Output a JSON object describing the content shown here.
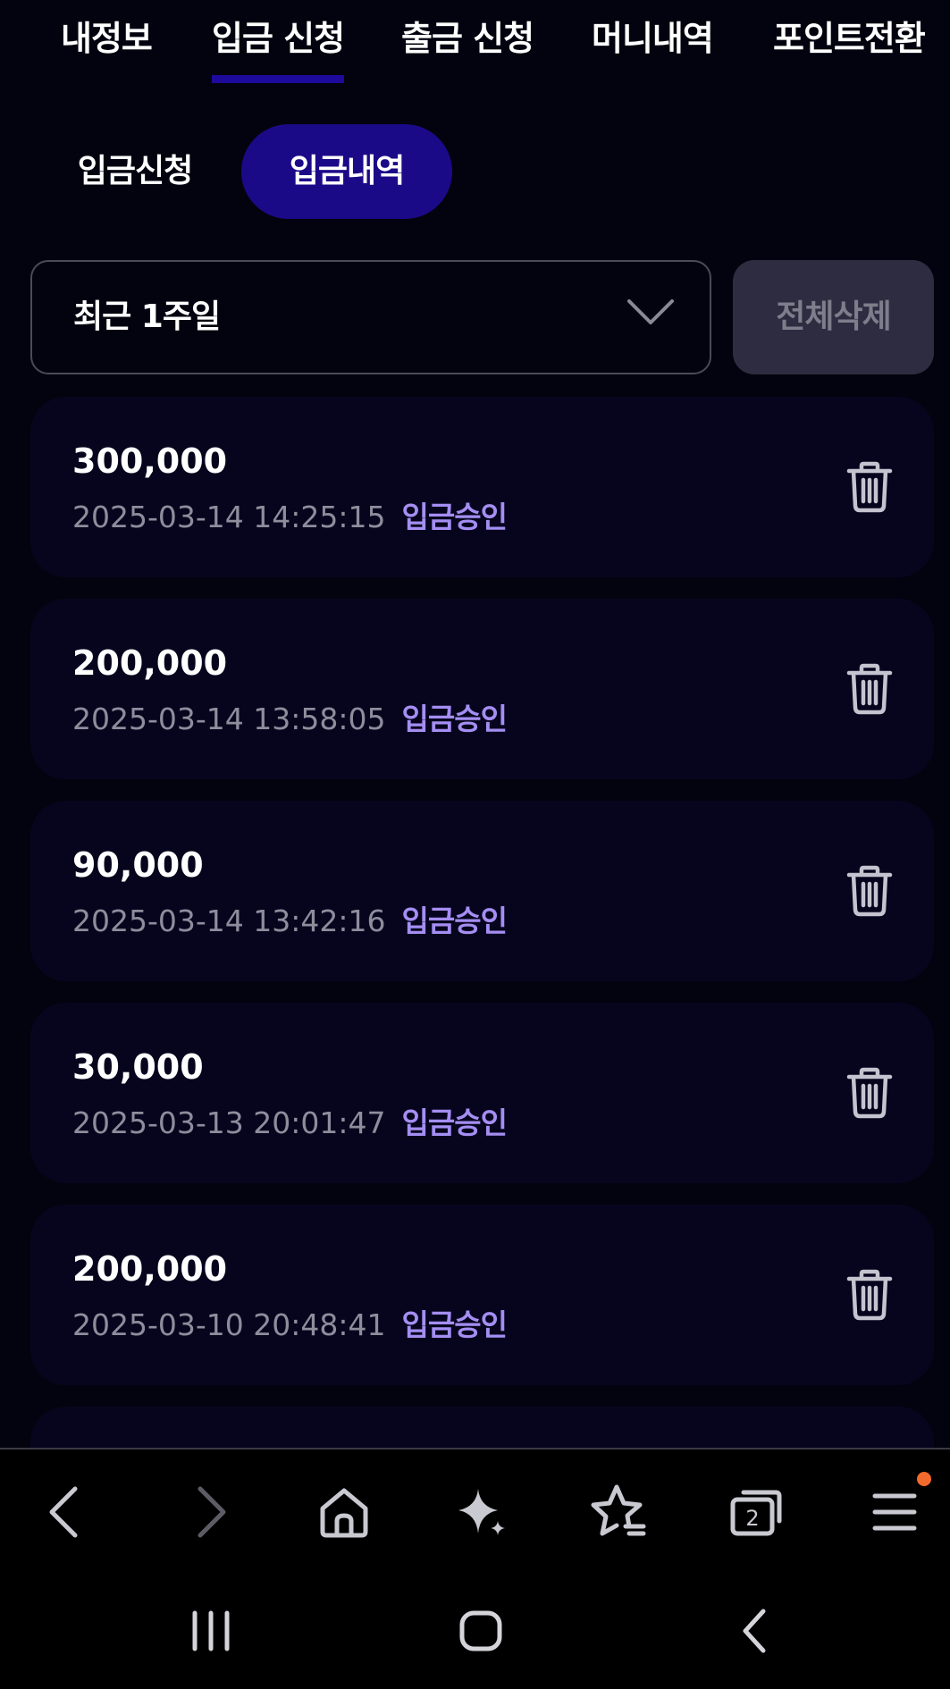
{
  "top_tabs": [
    {
      "label": "내정보"
    },
    {
      "label": "입금 신청"
    },
    {
      "label": "출금 신청"
    },
    {
      "label": "머니내역"
    },
    {
      "label": "포인트전환"
    }
  ],
  "active_top_tab": "입금 신청",
  "sub_tabs": {
    "apply": "입금신청",
    "history": "입금내역"
  },
  "active_sub_tab": "입금내역",
  "filter": {
    "period": "최근 1주일",
    "delete_all": "전체삭제"
  },
  "records": [
    {
      "amount": "300,000",
      "datetime": "2025-03-14 14:25:15",
      "status": "입금승인"
    },
    {
      "amount": "200,000",
      "datetime": "2025-03-14 13:58:05",
      "status": "입금승인"
    },
    {
      "amount": "90,000",
      "datetime": "2025-03-14 13:42:16",
      "status": "입금승인"
    },
    {
      "amount": "30,000",
      "datetime": "2025-03-13 20:01:47",
      "status": "입금승인"
    },
    {
      "amount": "200,000",
      "datetime": "2025-03-10 20:48:41",
      "status": "입금승인"
    }
  ],
  "browser_bar": {
    "tab_count": "2",
    "icons": [
      "back-icon",
      "forward-icon",
      "home-icon",
      "sparkle-icon",
      "bookmark-star-icon",
      "tabs-icon",
      "menu-icon"
    ]
  },
  "colors": {
    "background": "#03030f",
    "card": "#07051e",
    "accent": "#1b0a88",
    "tab_underline": "#1d0a9b",
    "status": "#a48ef2",
    "notification": "#f26a2c"
  }
}
